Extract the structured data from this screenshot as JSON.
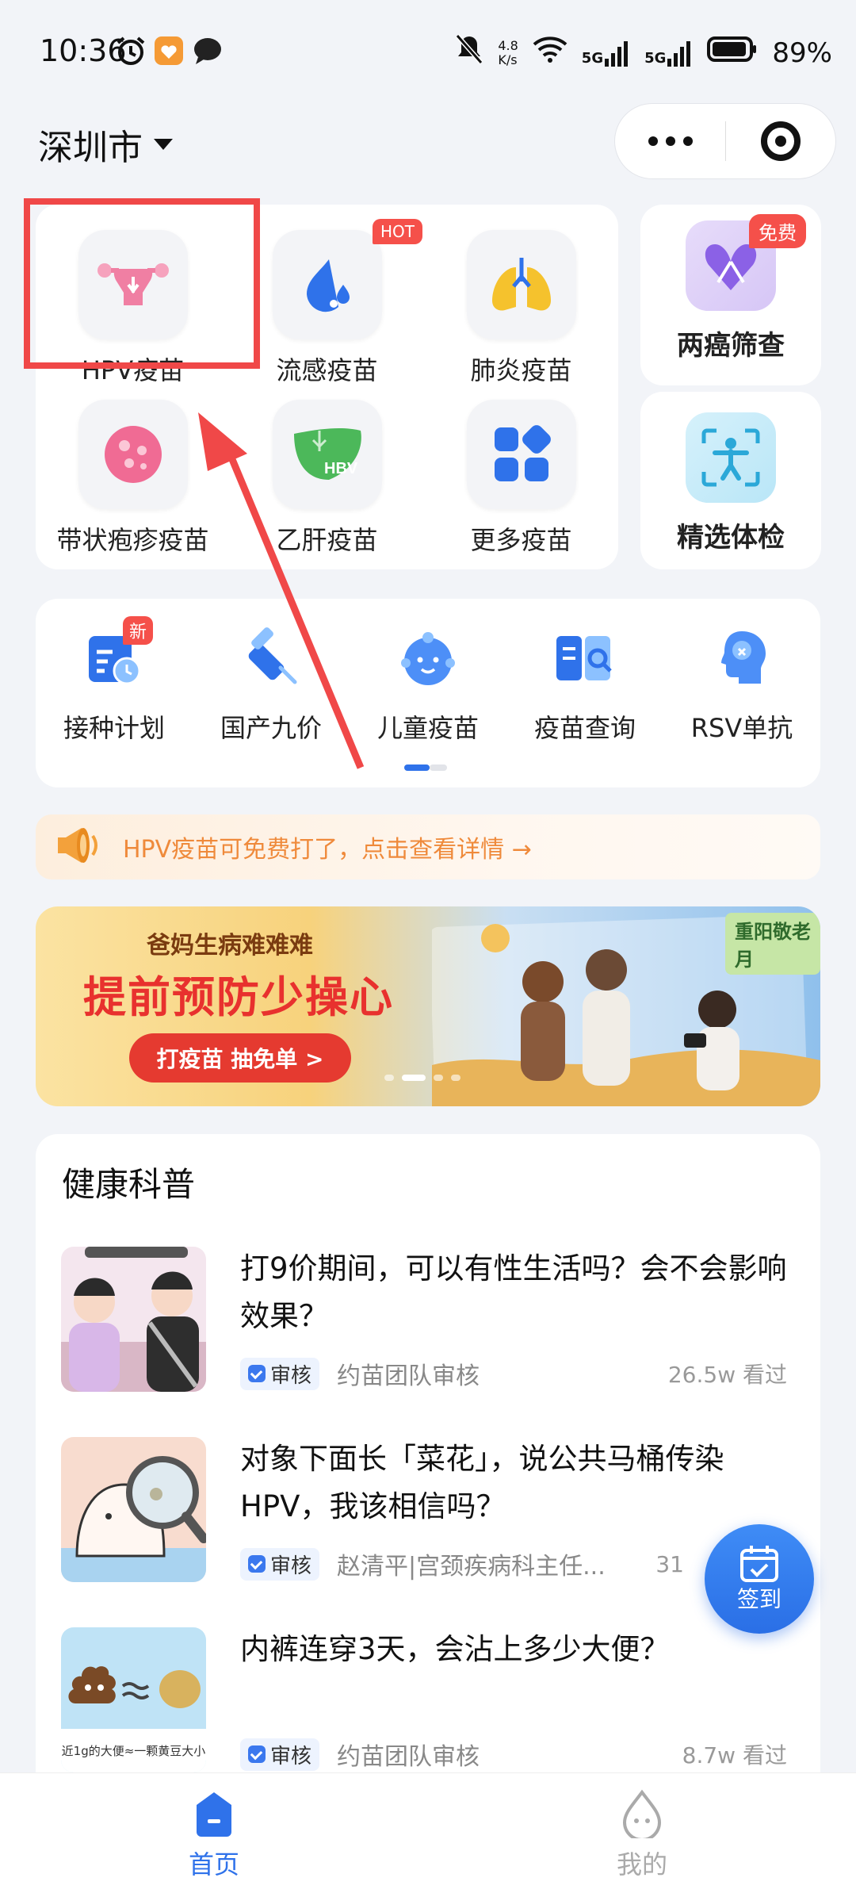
{
  "status_bar": {
    "time": "10:36",
    "net_speed_top": "4.8",
    "net_speed_bottom": "K/s",
    "signal1": "5G",
    "signal2": "5G",
    "battery": "89%"
  },
  "header": {
    "city": "深圳市"
  },
  "vaccines": [
    {
      "label": "HPV疫苗",
      "icon": "uterus-icon"
    },
    {
      "label": "流感疫苗",
      "icon": "flu-drop-icon",
      "badge": "HOT"
    },
    {
      "label": "肺炎疫苗",
      "icon": "lungs-icon"
    },
    {
      "label": "带状疱疹疫苗",
      "icon": "shingles-icon"
    },
    {
      "label": "乙肝疫苗",
      "icon": "liver-icon",
      "icon_text": "HBV"
    },
    {
      "label": "更多疫苗",
      "icon": "more-grid-icon"
    }
  ],
  "side_cards": [
    {
      "label": "两癌筛查",
      "badge": "免费",
      "icon": "ribbon-icon"
    },
    {
      "label": "精选体检",
      "icon": "body-scan-icon"
    }
  ],
  "quick": [
    {
      "label": "接种计划",
      "badge": "新",
      "icon": "calendar-clock-icon"
    },
    {
      "label": "国产九价",
      "icon": "syringe-icon"
    },
    {
      "label": "儿童疫苗",
      "icon": "baby-face-icon"
    },
    {
      "label": "疫苗查询",
      "icon": "book-search-icon"
    },
    {
      "label": "RSV单抗",
      "icon": "head-shield-icon"
    }
  ],
  "notice": {
    "text": "HPV疫苗可免费打了，点击查看详情 →"
  },
  "banner": {
    "subtitle": "爸妈生病难难难",
    "title": "提前预防少操心",
    "button": "打疫苗 抽免单 >",
    "tag": "重阳敬老月"
  },
  "health": {
    "title": "健康科普",
    "articles": [
      {
        "title": "打9价期间，可以有性生活吗？会不会影响效果？",
        "audit": "审核",
        "author": "约苗团队审核",
        "views": "26.5w 看过"
      },
      {
        "title": "对象下面长「菜花」，说公共马桶传染HPV，我该相信吗？",
        "audit": "审核",
        "author": "赵清平|宫颈疾病科主任...",
        "views": "31"
      },
      {
        "title": "内裤连穿3天，会沾上多少大便？",
        "audit": "审核",
        "author": "约苗团队审核",
        "views": "8.7w 看过",
        "thumb_caption": "近1g的大便≈一颗黄豆大小"
      }
    ]
  },
  "fab": {
    "label": "签到"
  },
  "tabs": [
    {
      "label": "首页",
      "active": true
    },
    {
      "label": "我的",
      "active": false
    }
  ],
  "colors": {
    "accent": "#2f72ea",
    "hot": "#f5504a",
    "notice": "#ef8a3b",
    "annotation": "#f04848"
  }
}
